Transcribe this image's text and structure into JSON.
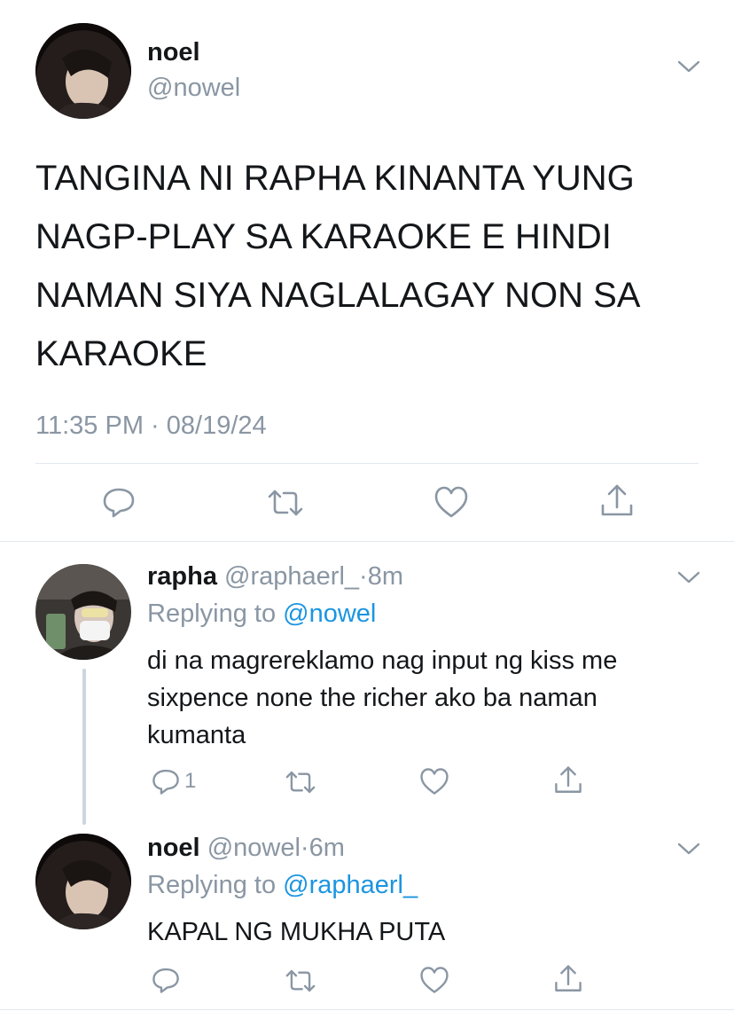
{
  "main_tweet": {
    "name": "noel",
    "handle": "@nowel",
    "text_lines": [
      "TANGINA NI RAPHA KINANTA YUNG",
      "NAGP-PLAY SA KARAOKE E HINDI",
      "NAMAN SIYA NAGLALAGAY NON SA",
      "KARAOKE"
    ],
    "time": "11:35 PM",
    "separator": "·",
    "date": "08/19/24",
    "actions": [
      "reply-icon",
      "retweet-icon",
      "like-icon",
      "share-icon"
    ]
  },
  "replies": [
    {
      "name": "rapha",
      "handle": "@raphaerl_",
      "separator": "·",
      "time": "8m",
      "replying_prefix": "Replying to",
      "replying_to": "@nowel",
      "text_lines": [
        "di na magrereklamo nag input ng kiss me",
        "sixpence none the richer ako ba naman",
        "kumanta"
      ],
      "reply_count": "1"
    },
    {
      "name": "noel",
      "handle": "@nowel",
      "separator": "·",
      "time": "6m",
      "replying_prefix": "Replying to",
      "replying_to": "@raphaerl_",
      "text_lines": [
        "KAPAL NG MUKHA PUTA"
      ],
      "reply_count": ""
    }
  ],
  "colors": {
    "text": "#14171a",
    "secondary": "#8a96a3",
    "link": "#1b95e0",
    "divider": "#e1e8ed",
    "thread_line": "#ccd6dd"
  }
}
